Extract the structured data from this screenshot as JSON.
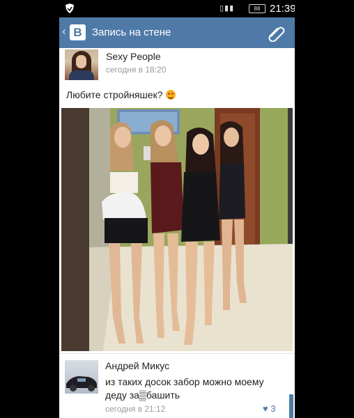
{
  "status_bar": {
    "time": "21:39",
    "battery": "88",
    "icons": [
      "shield-icon",
      "vibrate-icon",
      "signal-icon",
      "battery-icon"
    ]
  },
  "toolbar": {
    "back_glyph": "‹",
    "logo_text": "B",
    "title": "Запись на стене",
    "attach_icon": "paperclip-icon",
    "accent": "#4f7aa7"
  },
  "post": {
    "author": "Sexy People",
    "time": "сегодня в 18:20",
    "text": "Любите стройняшек?",
    "emoji": "blushing-smile-emoji"
  },
  "comment": {
    "author": "Андрей Микус",
    "text": "из таких досок забор можно моему деду за▒башить",
    "time": "сегодня в 21:12",
    "likes": "3",
    "like_icon": "heart-icon"
  }
}
